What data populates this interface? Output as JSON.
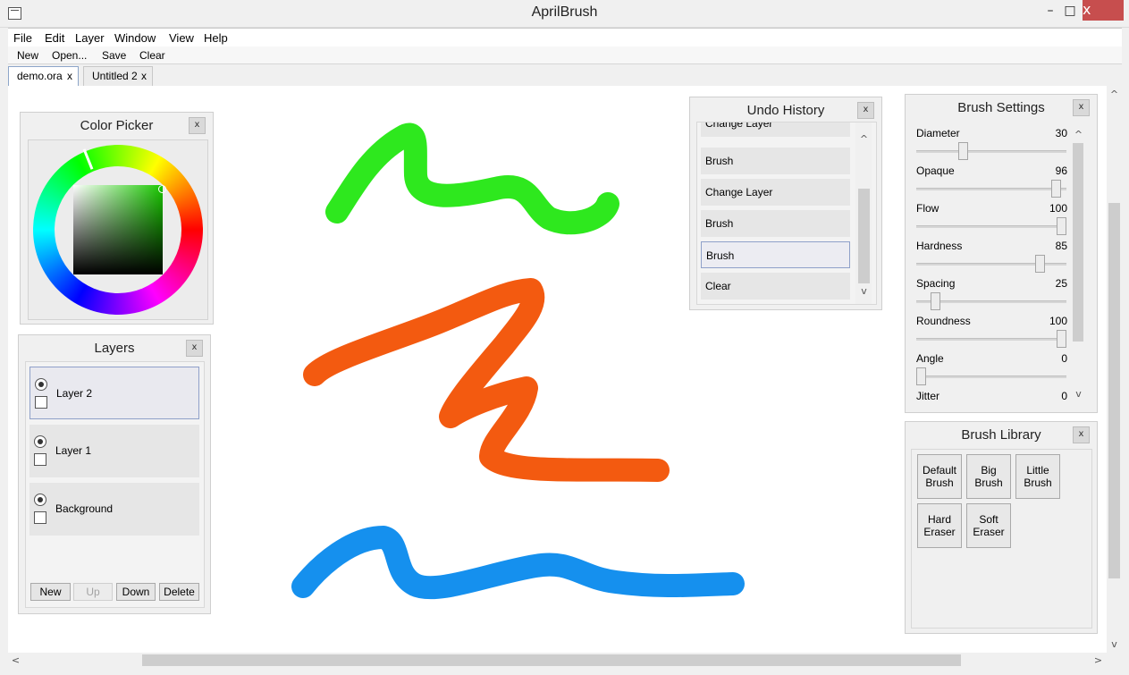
{
  "window": {
    "title": "AprilBrush",
    "minimize": "–",
    "maximize": "□",
    "close": "x"
  },
  "menu": [
    "File",
    "Edit",
    "Layer",
    "Window",
    "View",
    "Help"
  ],
  "toolbar": [
    "New",
    "Open...",
    "Save",
    "Clear"
  ],
  "tabs": [
    {
      "label": "demo.ora",
      "close": "x"
    },
    {
      "label": "Untitled 2",
      "close": "x"
    }
  ],
  "color_picker": {
    "title": "Color Picker",
    "close": "x",
    "selected_color": "#7ddc6a"
  },
  "layers": {
    "title": "Layers",
    "close": "x",
    "items": [
      {
        "label": "Layer 2"
      },
      {
        "label": "Layer 1"
      },
      {
        "label": "Background"
      }
    ],
    "buttons": {
      "new": "New",
      "up": "Up",
      "down": "Down",
      "delete": "Delete"
    }
  },
  "undo_history": {
    "title": "Undo History",
    "close": "x",
    "items": [
      "Change Layer",
      "Brush",
      "Change Layer",
      "Brush",
      "Brush",
      "Clear"
    ],
    "selected_index": 4
  },
  "brush_settings": {
    "title": "Brush Settings",
    "close": "x",
    "params": [
      {
        "label": "Diameter",
        "value": "30",
        "level": 0.3
      },
      {
        "label": "Opaque",
        "value": "96",
        "level": 0.96
      },
      {
        "label": "Flow",
        "value": "100",
        "level": 1.0
      },
      {
        "label": "Hardness",
        "value": "85",
        "level": 0.85
      },
      {
        "label": "Spacing",
        "value": "25",
        "level": 0.1
      },
      {
        "label": "Roundness",
        "value": "100",
        "level": 1.0
      },
      {
        "label": "Angle",
        "value": "0",
        "level": 0.0
      },
      {
        "label": "Jitter",
        "value": "0",
        "level": 0.0
      }
    ]
  },
  "brush_library": {
    "title": "Brush Library",
    "close": "x",
    "brushes": [
      "Default Brush",
      "Big Brush",
      "Little Brush",
      "Hard Eraser",
      "Soft Eraser"
    ]
  },
  "strokes": {
    "green": "#2ee81e",
    "orange": "#f35a10",
    "blue": "#1590ee"
  },
  "scroll_arrows": {
    "up": "^",
    "down": "v",
    "left": "<",
    "right": ">"
  }
}
